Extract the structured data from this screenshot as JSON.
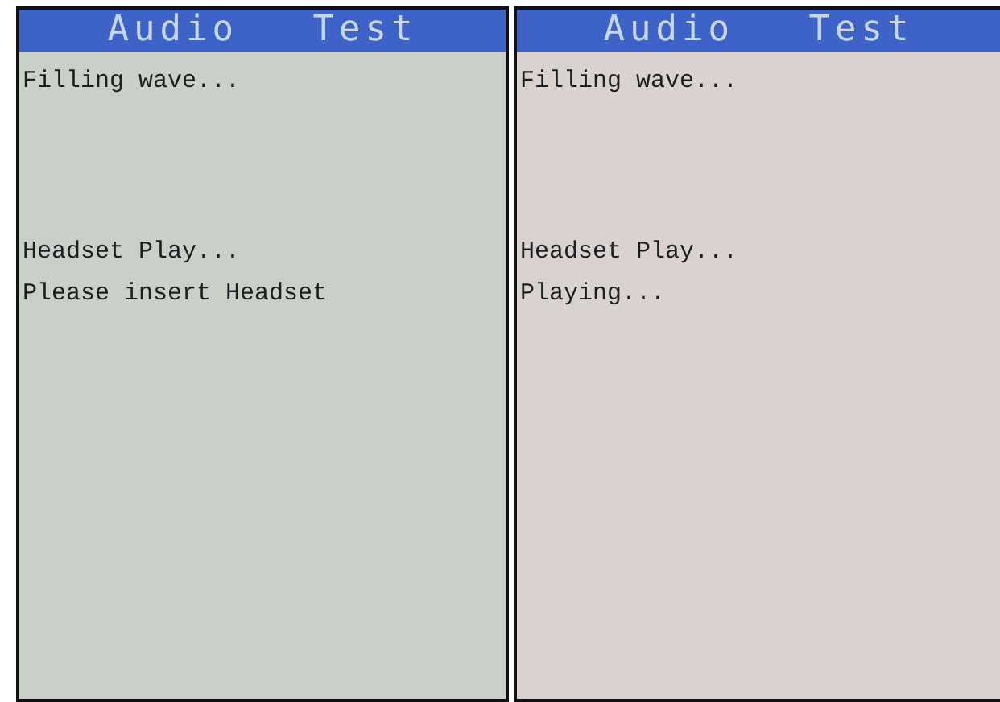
{
  "screens": [
    {
      "title": "Audio Test",
      "groups": [
        [
          "Filling wave..."
        ],
        [
          "Headset Play...",
          "Please insert Headset"
        ]
      ]
    },
    {
      "title": "Audio Test",
      "groups": [
        [
          "Filling wave..."
        ],
        [
          "Headset Play...",
          "Playing..."
        ]
      ]
    }
  ]
}
